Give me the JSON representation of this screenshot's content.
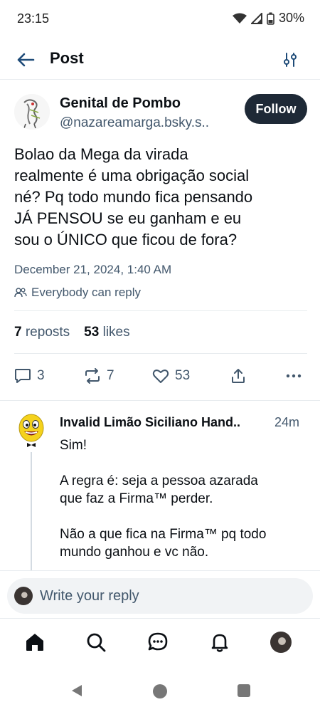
{
  "status_bar": {
    "time": "23:15",
    "battery": "30%",
    "icons": [
      "wifi-icon",
      "signal-icon",
      "battery-icon"
    ]
  },
  "header": {
    "title": "Post",
    "back_icon": "back-arrow-icon",
    "filter_icon": "sliders-icon"
  },
  "post": {
    "author_name": "Genital de Pombo",
    "author_handle": "@nazareamarga.bsky.s..",
    "follow_label": "Follow",
    "text": "Bolao da Mega da virada\nrealmente é uma obrigação social\nné? Pq todo mundo fica pensando\nJÁ PENSOU se eu ganham e eu\nsou o ÚNICO que ficou de fora?",
    "date": "December 21, 2024, 1:40 AM",
    "reply_setting": "Everybody can reply",
    "reposts_count": "7",
    "reposts_label": "reposts",
    "likes_count": "53",
    "likes_label": "likes",
    "actions": {
      "replies": "3",
      "reposts": "7",
      "likes": "53"
    }
  },
  "reply": {
    "author_name": "Invalid Limão Siciliano Hand..",
    "time": "24m",
    "text": "Sim!\n\nA regra é: seja a pessoa azarada\nque faz a Firma™ perder.\n\nNão a que fica na Firma™ pq todo\nmundo ganhou e vc não."
  },
  "composer": {
    "placeholder": "Write your reply"
  },
  "bottom_nav": [
    "home-icon",
    "search-icon",
    "chat-icon",
    "bell-icon",
    "profile-avatar"
  ],
  "colors": {
    "text": "#0b0f14",
    "muted": "#42576c",
    "follow_bg": "#1e2936",
    "divider": "#e8ecef",
    "accent_blue": "#1083fe"
  }
}
